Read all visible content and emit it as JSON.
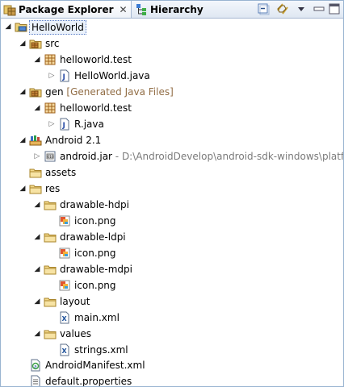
{
  "tabs": [
    {
      "label": "Package Explorer",
      "close": "✕",
      "icon": "package-explorer-icon"
    },
    {
      "label": "Hierarchy",
      "icon": "hierarchy-icon"
    }
  ],
  "toolbar": {
    "buttons": [
      "collapse-all-icon",
      "link-with-editor-icon",
      "view-menu-icon",
      "minimize-icon",
      "maximize-icon"
    ]
  },
  "tree": [
    {
      "label": "HelloWorld",
      "icon": "project-icon",
      "expanded": true,
      "selected": true
    },
    {
      "label": "src",
      "icon": "source-folder-icon",
      "expanded": true
    },
    {
      "label": "helloworld.test",
      "icon": "package-icon",
      "expanded": true
    },
    {
      "label": "HelloWorld.java",
      "icon": "java-file-icon",
      "expanded": false
    },
    {
      "label": "gen",
      "decoration": "[Generated Java Files]",
      "icon": "source-folder-icon",
      "expanded": true
    },
    {
      "label": "helloworld.test",
      "icon": "package-icon",
      "expanded": true
    },
    {
      "label": "R.java",
      "icon": "java-file-icon",
      "expanded": false
    },
    {
      "label": "Android 2.1",
      "icon": "library-icon",
      "expanded": true
    },
    {
      "label": "android.jar",
      "path": " - D:\\AndroidDevelop\\android-sdk-windows\\platfo",
      "icon": "jar-icon",
      "expanded": false
    },
    {
      "label": "assets",
      "icon": "folder-icon"
    },
    {
      "label": "res",
      "icon": "folder-icon",
      "expanded": true
    },
    {
      "label": "drawable-hdpi",
      "icon": "folder-icon",
      "expanded": true
    },
    {
      "label": "icon.png",
      "icon": "image-file-icon"
    },
    {
      "label": "drawable-ldpi",
      "icon": "folder-icon",
      "expanded": true
    },
    {
      "label": "icon.png",
      "icon": "image-file-icon"
    },
    {
      "label": "drawable-mdpi",
      "icon": "folder-icon",
      "expanded": true
    },
    {
      "label": "icon.png",
      "icon": "image-file-icon"
    },
    {
      "label": "layout",
      "icon": "folder-icon",
      "expanded": true
    },
    {
      "label": "main.xml",
      "icon": "xml-file-icon"
    },
    {
      "label": "values",
      "icon": "folder-icon",
      "expanded": true
    },
    {
      "label": "strings.xml",
      "icon": "xml-file-icon"
    },
    {
      "label": "AndroidManifest.xml",
      "icon": "manifest-file-icon"
    },
    {
      "label": "default.properties",
      "icon": "properties-file-icon"
    }
  ]
}
